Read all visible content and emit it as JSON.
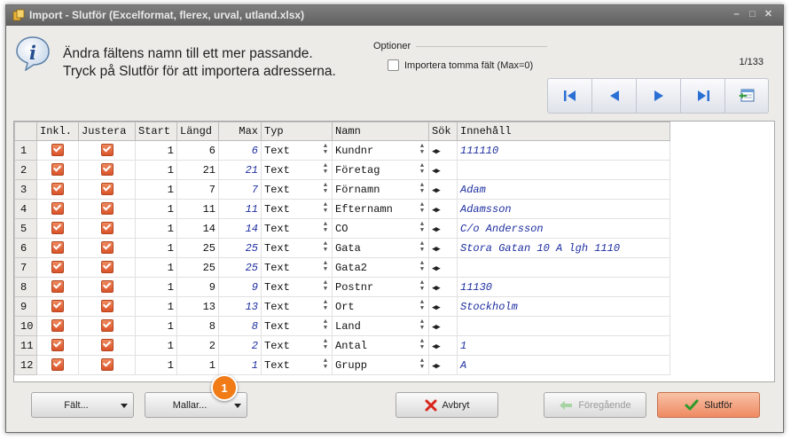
{
  "window": {
    "title": "Import - Slutför  (Excelformat, flerex, urval, utland.xlsx)",
    "controls": [
      "minimize-icon",
      "maximize-icon",
      "close-icon"
    ]
  },
  "header": {
    "instruction_line1": "Ändra fältens namn till ett mer passande.",
    "instruction_line2": "Tryck på Slutför för att importera adresserna.",
    "options_label": "Optioner",
    "import_empty_label": "Importera tomma fält (Max=0)",
    "import_empty_checked": false,
    "record_counter": "1/133"
  },
  "nav_buttons": [
    "first-record-icon",
    "previous-record-icon",
    "next-record-icon",
    "last-record-icon",
    "export-window-icon"
  ],
  "grid": {
    "columns": [
      "Inkl.",
      "Justera",
      "Start",
      "Längd",
      "Max",
      "Typ",
      "Namn",
      "Sök",
      "Innehåll"
    ],
    "rows": [
      {
        "num": "1",
        "inkl": true,
        "justera": true,
        "start": "1",
        "langd": "6",
        "max": "6",
        "typ": "Text",
        "namn": "Kundnr",
        "innehall": "111110"
      },
      {
        "num": "2",
        "inkl": true,
        "justera": true,
        "start": "1",
        "langd": "21",
        "max": "21",
        "typ": "Text",
        "namn": "Företag",
        "innehall": ""
      },
      {
        "num": "3",
        "inkl": true,
        "justera": true,
        "start": "1",
        "langd": "7",
        "max": "7",
        "typ": "Text",
        "namn": "Förnamn",
        "innehall": "Adam"
      },
      {
        "num": "4",
        "inkl": true,
        "justera": true,
        "start": "1",
        "langd": "11",
        "max": "11",
        "typ": "Text",
        "namn": "Efternamn",
        "innehall": "Adamsson"
      },
      {
        "num": "5",
        "inkl": true,
        "justera": true,
        "start": "1",
        "langd": "14",
        "max": "14",
        "typ": "Text",
        "namn": "CO",
        "innehall": "C/o Andersson"
      },
      {
        "num": "6",
        "inkl": true,
        "justera": true,
        "start": "1",
        "langd": "25",
        "max": "25",
        "typ": "Text",
        "namn": "Gata",
        "innehall": "Stora Gatan 10 A lgh 1110"
      },
      {
        "num": "7",
        "inkl": true,
        "justera": true,
        "start": "1",
        "langd": "25",
        "max": "25",
        "typ": "Text",
        "namn": "Gata2",
        "innehall": ""
      },
      {
        "num": "8",
        "inkl": true,
        "justera": true,
        "start": "1",
        "langd": "9",
        "max": "9",
        "typ": "Text",
        "namn": "Postnr",
        "innehall": "11130"
      },
      {
        "num": "9",
        "inkl": true,
        "justera": true,
        "start": "1",
        "langd": "13",
        "max": "13",
        "typ": "Text",
        "namn": "Ort",
        "innehall": "Stockholm"
      },
      {
        "num": "10",
        "inkl": true,
        "justera": true,
        "start": "1",
        "langd": "8",
        "max": "8",
        "typ": "Text",
        "namn": "Land",
        "innehall": ""
      },
      {
        "num": "11",
        "inkl": true,
        "justera": true,
        "start": "1",
        "langd": "2",
        "max": "2",
        "typ": "Text",
        "namn": "Antal",
        "innehall": "1"
      },
      {
        "num": "12",
        "inkl": true,
        "justera": true,
        "start": "1",
        "langd": "1",
        "max": "1",
        "typ": "Text",
        "namn": "Grupp",
        "innehall": "A"
      }
    ]
  },
  "footer": {
    "falt_label": "Fält...",
    "mallar_label": "Mallar...",
    "badge_number": "1",
    "cancel_label": "Avbryt",
    "prev_label": "Föregående",
    "finish_label": "Slutför"
  },
  "colors": {
    "accent_orange": "#f07b17",
    "checkbox_orange": "#e0673a",
    "finish_button": "#f3a07c",
    "content_blue": "#1e2fa0",
    "titlebar": "#6e6e6e"
  }
}
